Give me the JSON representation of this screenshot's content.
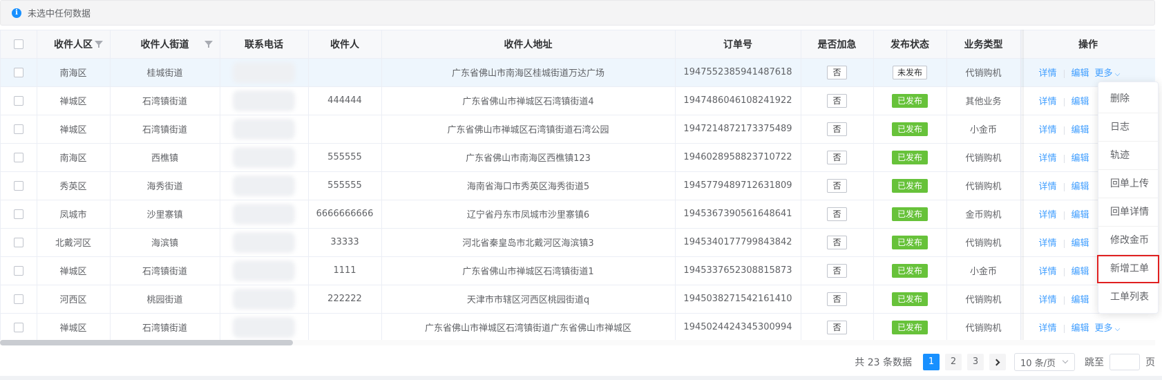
{
  "alert": {
    "icon": "info-icon",
    "text": "未选中任何数据"
  },
  "table": {
    "columns": [
      "",
      "收件人区",
      "收件人街道",
      "联系电话",
      "收件人",
      "收件人地址",
      "订单号",
      "是否加急",
      "发布状态",
      "业务类型",
      "操作"
    ],
    "rows": [
      {
        "district": "南海区",
        "street": "桂城街道",
        "phone": "",
        "name": "",
        "address": "广东省佛山市南海区桂城街道万达广场",
        "order": "1947552385941487618",
        "urgent": "否",
        "status": "未发布",
        "type": "代销购机"
      },
      {
        "district": "禅城区",
        "street": "石湾镇街道",
        "phone": "",
        "name": "444444",
        "address": "广东省佛山市禅城区石湾镇街道4",
        "order": "1947486046108241922",
        "urgent": "否",
        "status": "已发布",
        "type": "其他业务"
      },
      {
        "district": "禅城区",
        "street": "石湾镇街道",
        "phone": "",
        "name": "",
        "address": "广东省佛山市禅城区石湾镇街道石湾公园",
        "order": "1947214872173375489",
        "urgent": "否",
        "status": "已发布",
        "type": "小金币"
      },
      {
        "district": "南海区",
        "street": "西樵镇",
        "phone": "",
        "name": "555555",
        "address": "广东省佛山市南海区西樵镇123",
        "order": "1946028958823710722",
        "urgent": "否",
        "status": "已发布",
        "type": "代销购机"
      },
      {
        "district": "秀英区",
        "street": "海秀街道",
        "phone": "",
        "name": "555555",
        "address": "海南省海口市秀英区海秀街道5",
        "order": "1945779489712631809",
        "urgent": "否",
        "status": "已发布",
        "type": "代销购机"
      },
      {
        "district": "凤城市",
        "street": "沙里寨镇",
        "phone": "",
        "name": "6666666666",
        "address": "辽宁省丹东市凤城市沙里寨镇6",
        "order": "1945367390561648641",
        "urgent": "否",
        "status": "已发布",
        "type": "金币购机"
      },
      {
        "district": "北戴河区",
        "street": "海滨镇",
        "phone": "",
        "name": "33333",
        "address": "河北省秦皇岛市北戴河区海滨镇3",
        "order": "1945340177799843842",
        "urgent": "否",
        "status": "已发布",
        "type": "代销购机"
      },
      {
        "district": "禅城区",
        "street": "石湾镇街道",
        "phone": "",
        "name": "1111",
        "address": "广东省佛山市禅城区石湾镇街道1",
        "order": "1945337652308815873",
        "urgent": "否",
        "status": "已发布",
        "type": "小金币"
      },
      {
        "district": "河西区",
        "street": "桃园街道",
        "phone": "",
        "name": "222222",
        "address": "天津市市辖区河西区桃园街道q",
        "order": "1945038271542161410",
        "urgent": "否",
        "status": "已发布",
        "type": "代销购机"
      },
      {
        "district": "禅城区",
        "street": "石湾镇街道",
        "phone": "",
        "name": "",
        "address": "广东省佛山市禅城区石湾镇街道广东省佛山市禅城区",
        "order": "1945024424345300994",
        "urgent": "否",
        "status": "已发布",
        "type": "代销购机"
      }
    ],
    "actions": {
      "detail": "详情",
      "edit": "编辑",
      "more": "更多"
    }
  },
  "dropdown": [
    "删除",
    "日志",
    "轨迹",
    "回单上传",
    "回单详情",
    "修改金币",
    "新增工单",
    "工单列表"
  ],
  "pagination": {
    "total": "共 23 条数据",
    "pages": [
      "1",
      "2",
      "3"
    ],
    "active": "1",
    "page_size": "10 条/页",
    "goto": "跳至",
    "page_suffix": "页"
  },
  "colors": {
    "primary": "#1890ff",
    "success": "#67c23a",
    "link": "#409eff",
    "highlight_border": "#e02020"
  }
}
